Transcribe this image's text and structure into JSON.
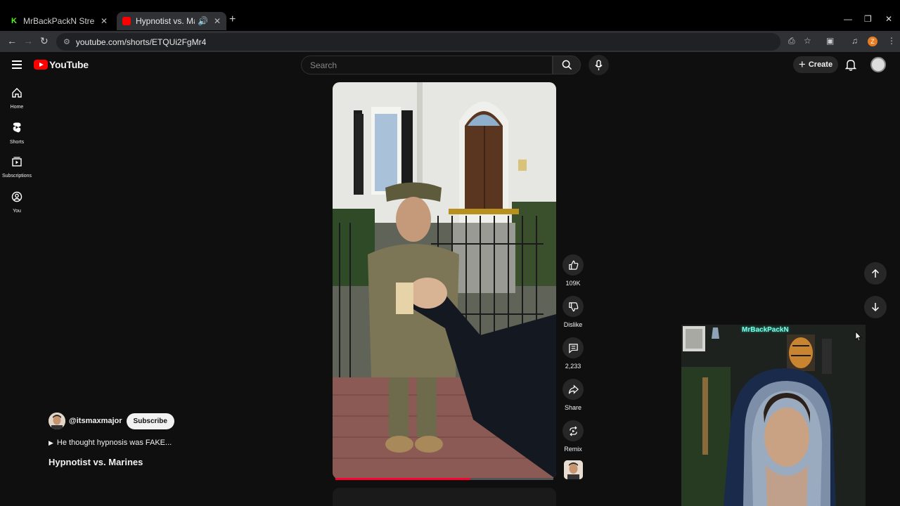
{
  "browser": {
    "tabs": [
      {
        "title": "MrBackPackN Stream - Watch Li",
        "favicon_color": "#53fc18",
        "active": false
      },
      {
        "title": "Hypnotist vs. Marines - You",
        "favicon_color": "#ff0000",
        "active": true
      }
    ],
    "url": "youtube.com/shorts/ETQUi2FgMr4",
    "profile_initial": "Z"
  },
  "youtube": {
    "logo_text": "YouTube",
    "search_placeholder": "Search",
    "create_label": "Create",
    "guide": [
      {
        "label": "Home",
        "icon": "home-icon"
      },
      {
        "label": "Shorts",
        "icon": "shorts-icon"
      },
      {
        "label": "Subscriptions",
        "icon": "subscriptions-icon"
      },
      {
        "label": "You",
        "icon": "you-icon"
      }
    ]
  },
  "short": {
    "channel_handle": "@itsmaxmajor",
    "subscribe_label": "Subscribe",
    "description": "He thought hypnosis was FAKE...",
    "title": "Hypnotist vs. Marines",
    "progress": 0.62,
    "actions": {
      "like_count": "109K",
      "dislike_label": "Dislike",
      "comment_count": "2,233",
      "share_label": "Share",
      "remix_label": "Remix"
    }
  },
  "overlay": {
    "streamer_name": "MrBackPackN"
  },
  "colors": {
    "accent": "#ff0000",
    "progress": "#ff0033",
    "background": "#0f0f0f"
  }
}
